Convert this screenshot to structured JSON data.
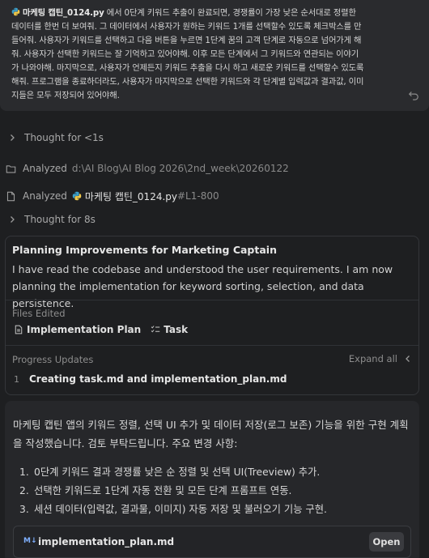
{
  "user_message": {
    "file_name": "마케팅 캡틴_0124.py",
    "text_lines": [
      "에서 0단계 키워드 추출이 완료되면, 경쟁률이 가장 낮은 순서대로 정렬한",
      "데이터를 한번 더 보여줘. 그 데이터에서 사용자가 원하는 키워드 1개를 선택할수 있도록 체크박스를 만",
      "들어줘. 사용자가 키워드를 선택하고 다음 버튼을 누르면 1단계 꿈의 고객 단계로 자동으로 넘어가게 해",
      "줘. 사용자가 선택한 키워드는 잘 기억하고 있어야해. 이후 모든 단계에서 그 키워드와 연관되는 이야기",
      "가 나와야해. 마지막으로, 사용자가 언제든지 키워드 추출을 다시 하고 새로운 키워드를 선택할수 있도록",
      "해줘. 프로그램을 종료하더라도, 사용자가 마지막으로 선택한 키워드와 각 단계별 입력값과 결과값, 이미",
      "지들은 모두 저장되어 있어야해."
    ]
  },
  "steps": {
    "thought1": "Thought for <1s",
    "analyzed1_label": "Analyzed",
    "analyzed1_path": "d:\\AI Blog\\AI Blog 2026\\2nd_week\\20260122",
    "analyzed2_label": "Analyzed",
    "analyzed2_file": "마케팅 캡틴_0124.py",
    "analyzed2_range": "#L1-800",
    "thought2": "Thought for 8s"
  },
  "plan": {
    "title": "Planning Improvements for Marketing Captain",
    "desc": "I have read the codebase and understood the user requirements. I am now planning the implementation for keyword sorting, selection, and data persistence.",
    "files_label": "Files Edited",
    "files": [
      "Implementation Plan",
      "Task"
    ],
    "progress_label": "Progress Updates",
    "expand_label": "Expand all",
    "progress_items": [
      {
        "num": "1",
        "text": "Creating task.md and implementation_plan.md"
      }
    ]
  },
  "reply": {
    "intro": "마케팅 캡틴 앱의 키워드 정렬, 선택 UI 추가 및 데이터 저장(로그 보존) 기능을 위한 구현 계획을 작성했습니다. 검토 부탁드립니다. 주요 변경 사항:",
    "items": [
      {
        "num": "1.",
        "text": "0단계 키워드 결과 경쟁률 낮은 순 정렬 및 선택 UI(Treeview) 추가."
      },
      {
        "num": "2.",
        "text": "선택한 키워드로 1단계 자동 전환 및 모든 단계 프롬프트 연동."
      },
      {
        "num": "3.",
        "text": "세션 데이터(입력값, 결과물, 이미지) 자동 저장 및 불러오기 기능 구현."
      }
    ],
    "artifact_icon": "M↓",
    "artifact_name": "implementation_plan.md",
    "open_label": "Open"
  }
}
